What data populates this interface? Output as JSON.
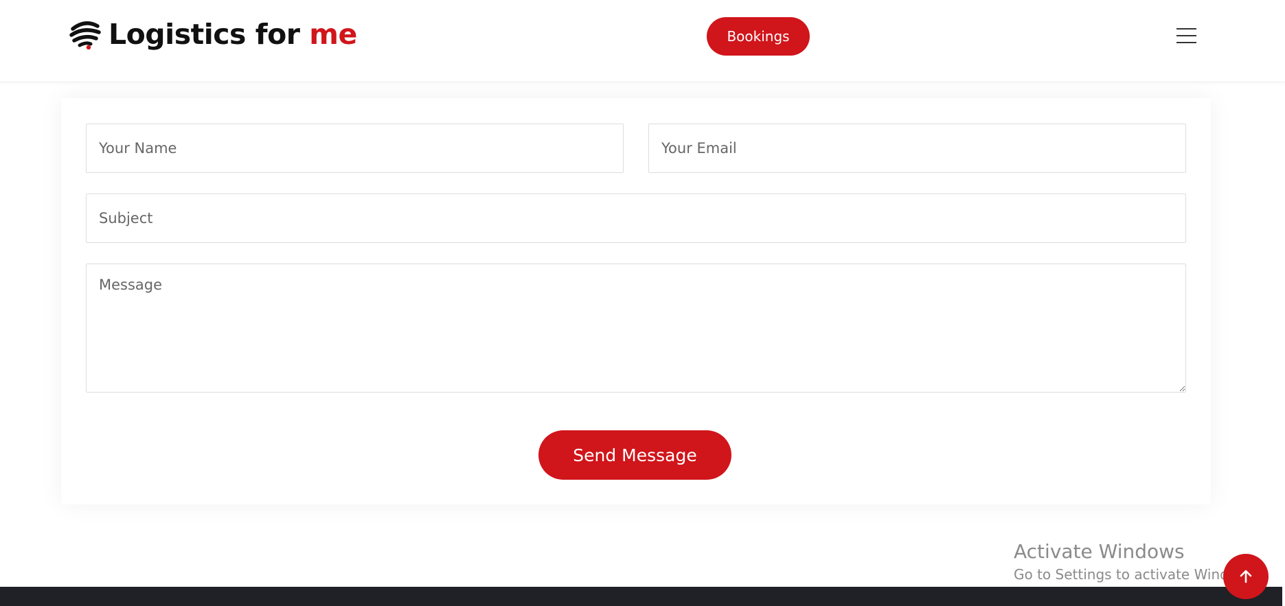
{
  "header": {
    "logo_text": "Logistics for ",
    "logo_accent": "me",
    "bookings_label": "Bookings",
    "menu_icon": "hamburger-menu-icon"
  },
  "form": {
    "name_placeholder": "Your Name",
    "email_placeholder": "Your Email",
    "subject_placeholder": "Subject",
    "message_placeholder": "Message",
    "submit_label": "Send Message"
  },
  "watermark": {
    "title": "Activate Windows",
    "subtitle": "Go to Settings to activate Windows."
  },
  "back_to_top_icon": "arrow-up-icon",
  "colors": {
    "accent": "#d0151b",
    "footer": "#1f2126",
    "text": "#111111"
  }
}
